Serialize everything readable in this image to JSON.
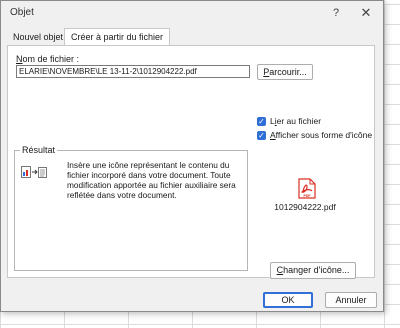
{
  "window": {
    "title": "Objet",
    "help_label": "?",
    "close_label": "✕"
  },
  "tabs": [
    {
      "label": "Nouvel objet"
    },
    {
      "label": "Créer à partir du fichier"
    }
  ],
  "file": {
    "label_key": "N",
    "label_rest": "om de fichier :",
    "value": "ELARIE\\NOVEMBRE\\LE 13-11-2\\1012904222.pdf",
    "browse_key": "P",
    "browse_rest": "arcourir..."
  },
  "options": {
    "link_pre": "L",
    "link_key": "i",
    "link_rest": "er au fichier",
    "link_checked": true,
    "icon_key": "A",
    "icon_rest": "fficher sous forme d'icône",
    "icon_checked": true
  },
  "result": {
    "title": "Résultat",
    "text": "Insère une icône représentant le contenu du fichier incorporé dans votre document. Toute modification apportée au fichier auxiliaire sera reflétée dans votre document."
  },
  "preview": {
    "filename": "1012904222.pdf",
    "icon": "pdf-file-icon",
    "pdf_text": "PDF"
  },
  "buttons": {
    "change_key": "C",
    "change_rest": "hanger d'icône...",
    "ok": "OK",
    "cancel": "Annuler"
  },
  "colors": {
    "accent": "#2f6fd6",
    "pdf_red": "#d93025",
    "dialog_bg": "#f0f0f0"
  }
}
